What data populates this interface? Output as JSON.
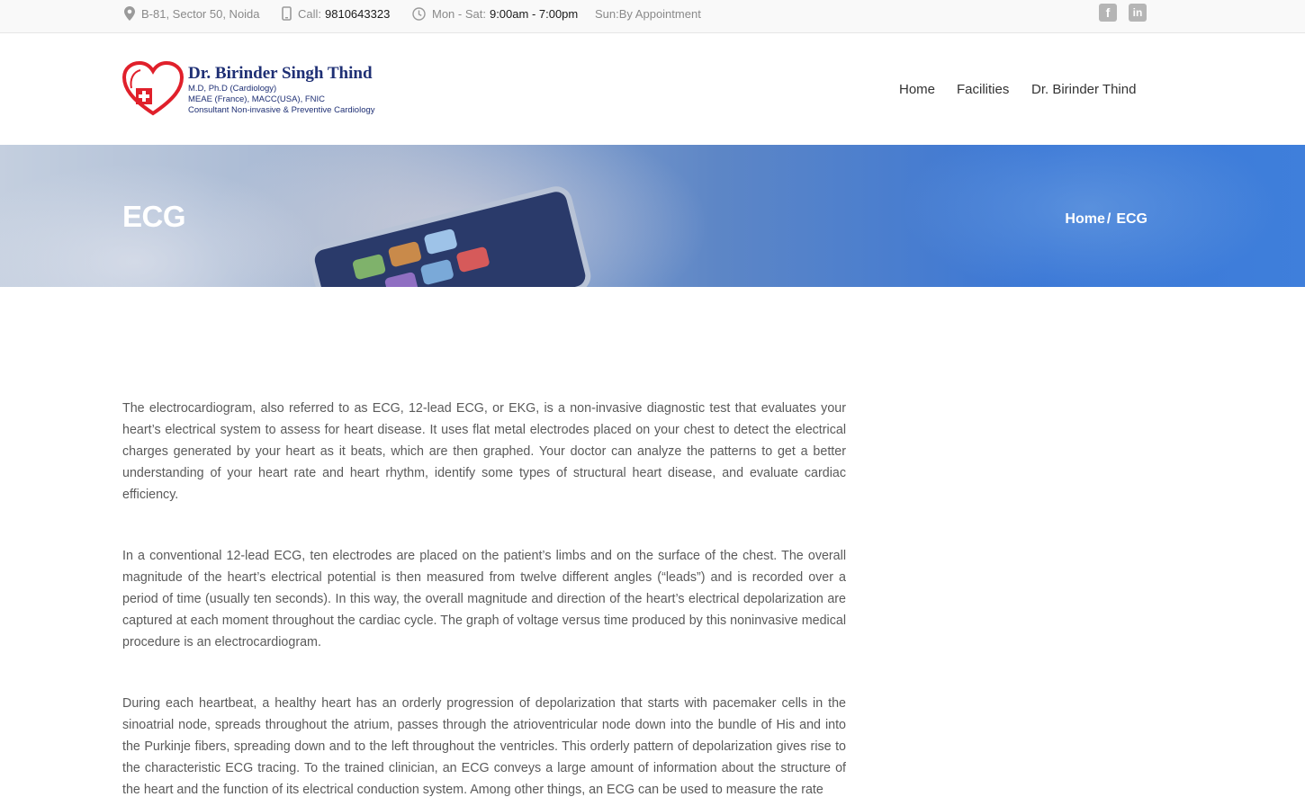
{
  "topbar": {
    "address": "B-81, Sector 50, Noida",
    "call_label": "Call:",
    "call_number": "9810643323",
    "hours_label": "Mon - Sat:",
    "hours_value": "9:00am - 7:00pm",
    "sunday": "Sun:By Appointment",
    "social": [
      "facebook-icon",
      "linkedin-icon"
    ]
  },
  "logo": {
    "name": "Dr. Birinder Singh Thind",
    "line1": "M.D, Ph.D (Cardiology)",
    "line2": "MEAE (France), MACC(USA), FNIC",
    "line3": "Consultant Non-invasive & Preventive Cardiology"
  },
  "nav": {
    "items": [
      "Home",
      "Facilities",
      "Dr. Birinder Thind"
    ]
  },
  "banner": {
    "title": "ECG",
    "breadcrumb_home": "Home",
    "breadcrumb_sep": "/",
    "breadcrumb_current": "ECG"
  },
  "content": {
    "paragraphs": [
      "The electrocardiogram, also referred to as ECG, 12-lead ECG, or EKG, is a non-invasive diagnostic test that evaluates your heart’s electrical system to assess for heart disease. It uses flat metal electrodes placed on your chest to detect the electrical charges generated by your heart as it beats, which are then graphed. Your doctor can analyze the patterns to get a better understanding of your heart rate and heart rhythm, identify some types of structural heart disease, and evaluate cardiac efficiency.",
      "In a conventional 12-lead ECG, ten electrodes are placed on the patient’s limbs and on the surface of the chest. The overall magnitude of the heart’s electrical potential is then measured from twelve different angles (“leads”) and is recorded over a period of time (usually ten seconds). In this way, the overall magnitude and direction of the heart’s electrical depolarization are captured at each moment throughout the cardiac cycle. The graph of voltage versus time produced by this noninvasive medical procedure is an electrocardiogram.",
      "During each heartbeat, a healthy heart has an orderly progression of depolarization that starts with pacemaker cells in the sinoatrial node, spreads throughout the atrium, passes through the atrioventricular node down into the bundle of His and into the Purkinje fibers, spreading down and to the left throughout the ventricles. This orderly pattern of depolarization gives rise to the characteristic ECG tracing. To the trained clinician, an ECG conveys a large amount of information about the structure of the heart and the function of its electrical conduction system. Among other things, an ECG can be used to measure the rate"
    ]
  },
  "colors": {
    "brand_navy": "#1e2f74",
    "brand_red": "#e0202b",
    "banner_blue": "#3a77d6"
  }
}
